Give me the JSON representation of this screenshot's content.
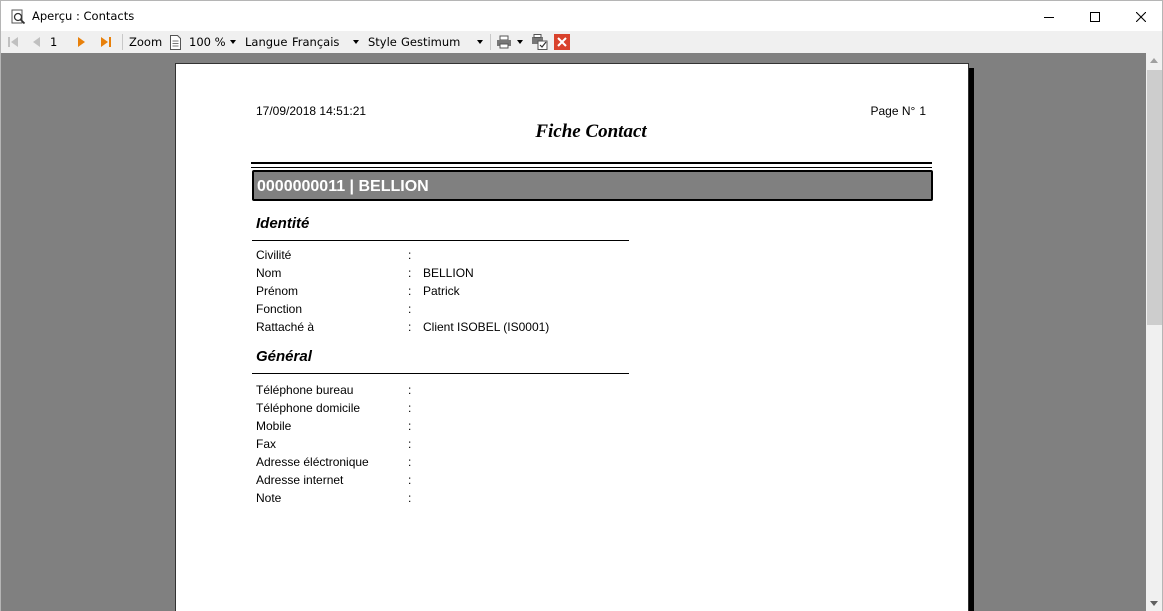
{
  "window": {
    "title": "Aperçu : Contacts",
    "icon": "print-preview-icon"
  },
  "toolbar": {
    "page_number": "1",
    "zoom_label": "Zoom",
    "zoom_value": "100 %",
    "langue_label": "Langue",
    "langue_value": "Français",
    "style_label": "Style",
    "style_value": "Gestimum"
  },
  "colors": {
    "viewer_bg": "#808080",
    "nav_orange": "#e8800a",
    "close_red": "#d9422c"
  },
  "report": {
    "date": "17/09/2018 14:51:21",
    "page_label": "Page N°",
    "page_number": "1",
    "title": "Fiche Contact",
    "banner": "0000000011 | BELLION",
    "sections": {
      "identite": {
        "title": "Identité",
        "rows": [
          {
            "label": "Civilité",
            "value": ""
          },
          {
            "label": "Nom",
            "value": "BELLION"
          },
          {
            "label": "Prénom",
            "value": "Patrick"
          },
          {
            "label": "Fonction",
            "value": ""
          },
          {
            "label": "Rattaché à",
            "value": "Client ISOBEL (IS0001)"
          }
        ]
      },
      "general": {
        "title": "Général",
        "rows": [
          {
            "label": "Téléphone bureau",
            "value": ""
          },
          {
            "label": "Téléphone domicile",
            "value": ""
          },
          {
            "label": "Mobile",
            "value": ""
          },
          {
            "label": "Fax",
            "value": ""
          },
          {
            "label": "Adresse éléctronique",
            "value": ""
          },
          {
            "label": "Adresse internet",
            "value": ""
          },
          {
            "label": "Note",
            "value": ""
          }
        ]
      }
    },
    "colon": ":"
  }
}
